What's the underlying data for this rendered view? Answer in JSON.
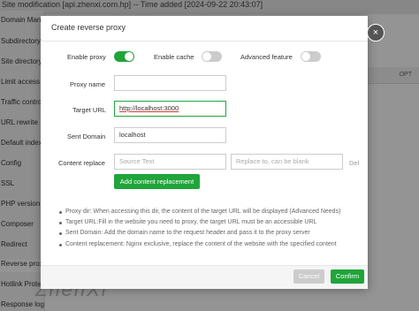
{
  "background": {
    "header_text": "Site modification [api.zhenxi.com.hp] -- Time added [2024-09-22 20:43:07]",
    "sidebar_items": [
      "Domain Manag",
      "Subdirectory b",
      "Site directory",
      "Limit access",
      "Traffic control",
      "URL rewrite",
      "Default index",
      "Config",
      "SSL",
      "PHP version",
      "Composer",
      "Redirect",
      "Reverse proxy",
      "Hotlink Protec",
      "Response log"
    ],
    "table_header_opt": "OPT",
    "watermark": "ZhenXi"
  },
  "dialog": {
    "title": "Create reverse proxy",
    "close_symbol": "×",
    "enable_proxy_label": "Enable proxy",
    "enable_proxy_on": true,
    "enable_cache_label": "Enable cache",
    "enable_cache_on": false,
    "advanced_feature_label": "Advanced feature",
    "advanced_feature_on": false,
    "proxy_name_label": "Proxy name",
    "proxy_name_value": "",
    "target_url_label": "Target URL",
    "target_url_value": "http://localhost:3000",
    "sent_domain_label": "Sent Domain",
    "sent_domain_value": "localhost",
    "content_replace_label": "Content replace",
    "source_text_placeholder": "Source Text",
    "replace_to_placeholder": "Replace to, can be blank",
    "del_label": "Del",
    "add_content_replacement_label": "Add content replacement",
    "notes": [
      "Proxy dir: When accessing this dir, the content of the target URL will be displayed (Advanced Needs)",
      "Target URL:Fill in the website you need to proxy, the target URL must be an accessible URL",
      "Sent Domain: Add the domain name to the request header and pass it to the proxy server",
      "Content replacement: Nginx exclusive, replace the content of the website with the specified content"
    ],
    "cancel_label": "Cancel",
    "confirm_label": "Confirm"
  },
  "colors": {
    "accent": "#20a53a",
    "overlay": "rgba(0,0,0,0.42)"
  }
}
